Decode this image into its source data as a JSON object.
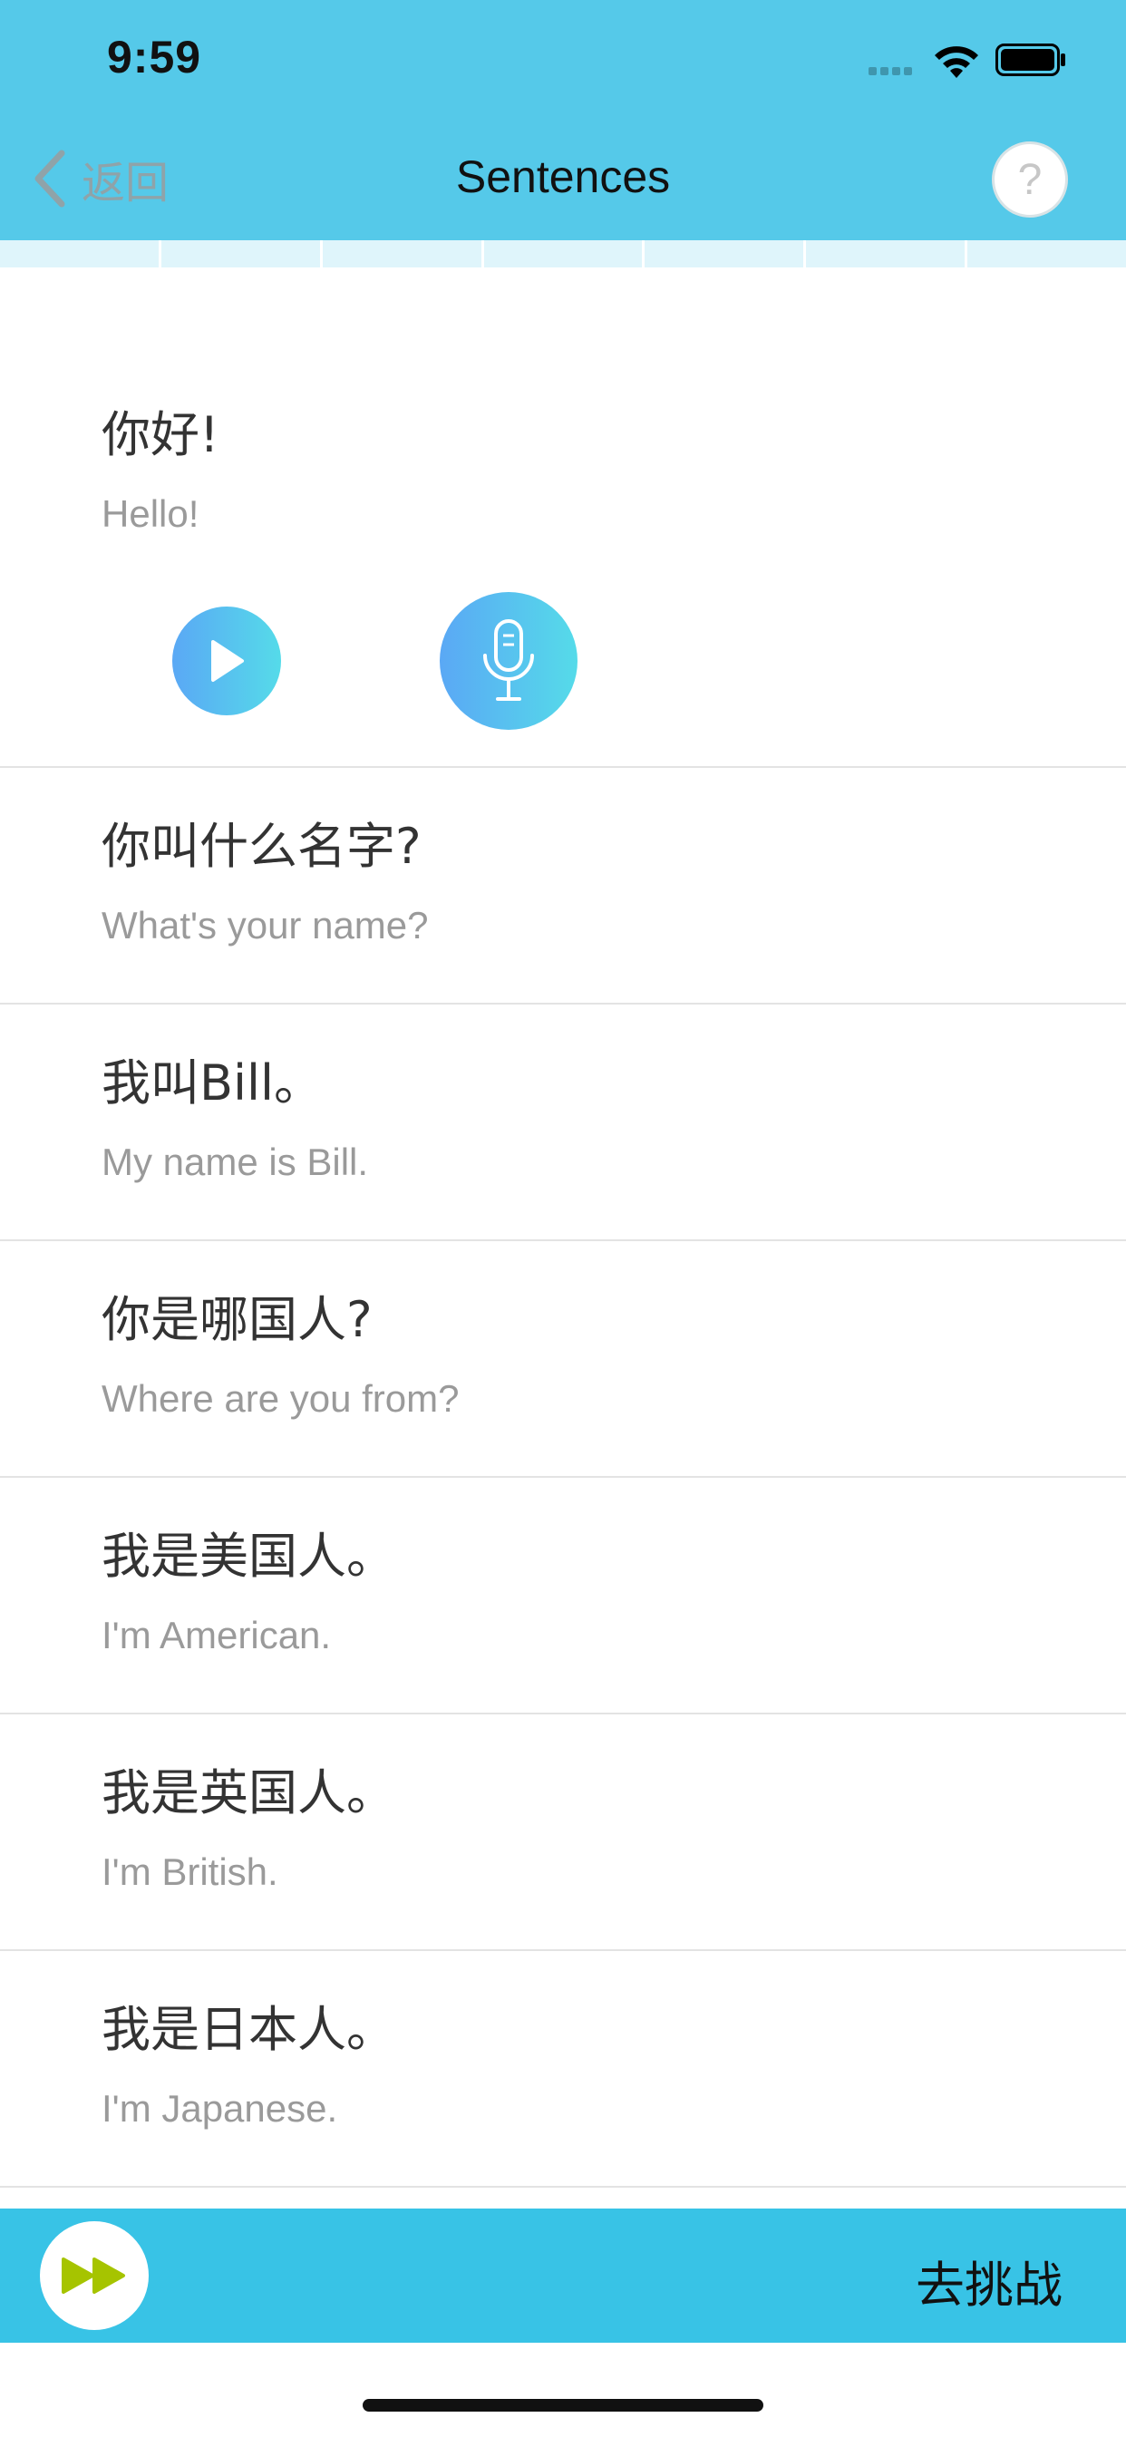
{
  "status_bar": {
    "time": "9:59",
    "icons": [
      "signal-icon",
      "wifi-icon",
      "battery-icon"
    ]
  },
  "nav": {
    "back_label": "返回",
    "title": "Sentences",
    "help_label": "?"
  },
  "progress": {
    "segments": 7
  },
  "sentences": [
    {
      "zh": "你好!",
      "en": "Hello!",
      "expanded": true
    },
    {
      "zh": "你叫什么名字?",
      "en": "What's your name?"
    },
    {
      "zh": "我叫Bill。",
      "en": "My name is Bill."
    },
    {
      "zh": "你是哪国人?",
      "en": "Where are you from?"
    },
    {
      "zh": "我是美国人。",
      "en": "I'm American."
    },
    {
      "zh": "我是英国人。",
      "en": "I'm British."
    },
    {
      "zh": "我是日本人。",
      "en": "I'm Japanese."
    }
  ],
  "bottom_bar": {
    "challenge_label": "去挑战"
  },
  "colors": {
    "header": "#55c9e9",
    "bottom_bar": "#38c3e6",
    "button_gradient_start": "#5aa8f5",
    "button_gradient_end": "#55dbe9",
    "fast_forward": "#a6c400"
  }
}
